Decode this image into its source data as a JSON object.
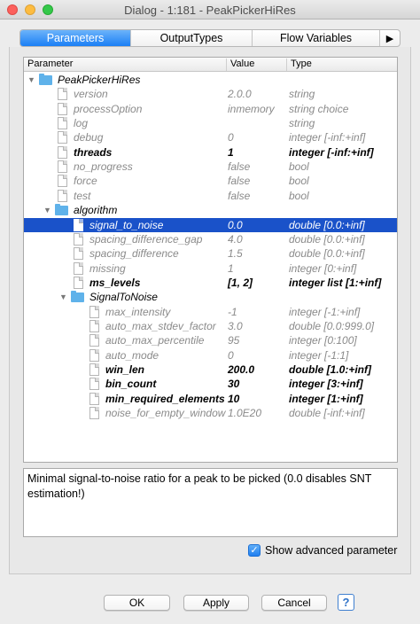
{
  "window": {
    "title": "Dialog - 1:181 - PeakPickerHiRes"
  },
  "tabs": [
    {
      "label": "Parameters",
      "active": true
    },
    {
      "label": "OutputTypes",
      "active": false
    },
    {
      "label": "Flow Variables",
      "active": false
    },
    {
      "label": "▶",
      "active": false
    }
  ],
  "table": {
    "columns": [
      "Parameter",
      "Value",
      "Type"
    ],
    "rows": [
      {
        "name": "PeakPickerHiRes",
        "value": "",
        "type": "",
        "kind": "folder",
        "depth": 0,
        "style": "dark",
        "arrow": "▼"
      },
      {
        "name": "version",
        "value": "2.0.0",
        "type": "string",
        "kind": "file",
        "depth": 1,
        "style": "muted"
      },
      {
        "name": "processOption",
        "value": "inmemory",
        "type": "string choice",
        "kind": "file",
        "depth": 1,
        "style": "muted"
      },
      {
        "name": "log",
        "value": "",
        "type": "string",
        "kind": "file",
        "depth": 1,
        "style": "muted"
      },
      {
        "name": "debug",
        "value": "0",
        "type": "integer [-inf:+inf]",
        "kind": "file",
        "depth": 1,
        "style": "muted"
      },
      {
        "name": "threads",
        "value": "1",
        "type": "integer [-inf:+inf]",
        "kind": "file",
        "depth": 1,
        "style": "bold"
      },
      {
        "name": "no_progress",
        "value": "false",
        "type": "bool",
        "kind": "file",
        "depth": 1,
        "style": "muted"
      },
      {
        "name": "force",
        "value": "false",
        "type": "bool",
        "kind": "file",
        "depth": 1,
        "style": "muted"
      },
      {
        "name": "test",
        "value": "false",
        "type": "bool",
        "kind": "file",
        "depth": 1,
        "style": "muted"
      },
      {
        "name": "algorithm",
        "value": "",
        "type": "",
        "kind": "folder",
        "depth": 1,
        "style": "dark",
        "arrow": "▼"
      },
      {
        "name": "signal_to_noise",
        "value": "0.0",
        "type": "double [0.0:+inf]",
        "kind": "file",
        "depth": 2,
        "style": "selected"
      },
      {
        "name": "spacing_difference_gap",
        "value": "4.0",
        "type": "double [0.0:+inf]",
        "kind": "file",
        "depth": 2,
        "style": "muted"
      },
      {
        "name": "spacing_difference",
        "value": "1.5",
        "type": "double [0.0:+inf]",
        "kind": "file",
        "depth": 2,
        "style": "muted"
      },
      {
        "name": "missing",
        "value": "1",
        "type": "integer [0:+inf]",
        "kind": "file",
        "depth": 2,
        "style": "muted"
      },
      {
        "name": "ms_levels",
        "value": "[1, 2]",
        "type": "integer list [1:+inf]",
        "kind": "file",
        "depth": 2,
        "style": "bold"
      },
      {
        "name": "SignalToNoise",
        "value": "",
        "type": "",
        "kind": "folder",
        "depth": 2,
        "style": "dark",
        "arrow": "▼"
      },
      {
        "name": "max_intensity",
        "value": "-1",
        "type": "integer [-1:+inf]",
        "kind": "file",
        "depth": 3,
        "style": "muted"
      },
      {
        "name": "auto_max_stdev_factor",
        "value": "3.0",
        "type": "double [0.0:999.0]",
        "kind": "file",
        "depth": 3,
        "style": "muted"
      },
      {
        "name": "auto_max_percentile",
        "value": "95",
        "type": "integer [0:100]",
        "kind": "file",
        "depth": 3,
        "style": "muted"
      },
      {
        "name": "auto_mode",
        "value": "0",
        "type": "integer [-1:1]",
        "kind": "file",
        "depth": 3,
        "style": "muted"
      },
      {
        "name": "win_len",
        "value": "200.0",
        "type": "double [1.0:+inf]",
        "kind": "file",
        "depth": 3,
        "style": "bold"
      },
      {
        "name": "bin_count",
        "value": "30",
        "type": "integer [3:+inf]",
        "kind": "file",
        "depth": 3,
        "style": "bold"
      },
      {
        "name": "min_required_elements",
        "value": "10",
        "type": "integer [1:+inf]",
        "kind": "file",
        "depth": 3,
        "style": "bold"
      },
      {
        "name": "noise_for_empty_window",
        "value": "1.0E20",
        "type": "double [-inf:+inf]",
        "kind": "file",
        "depth": 3,
        "style": "muted"
      }
    ]
  },
  "description": "Minimal signal-to-noise ratio for a peak to be picked (0.0 disables SNT estimation!)",
  "advanced": {
    "label": "Show advanced parameter",
    "checked": true
  },
  "buttons": {
    "ok": "OK",
    "apply": "Apply",
    "cancel": "Cancel",
    "help": "?"
  },
  "colors": {
    "accent": "#1a52c9",
    "tab_active": "#1b7ff5",
    "folder": "#5fb2ea"
  }
}
